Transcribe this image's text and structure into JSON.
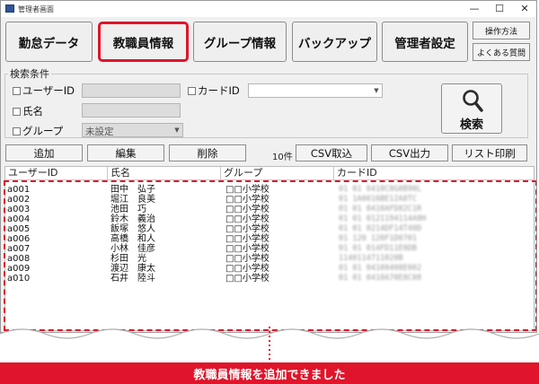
{
  "window": {
    "title": "管理者画面",
    "minimize": "—",
    "maximize": "☐",
    "close": "✕"
  },
  "tabs": [
    {
      "label": "勤怠データ",
      "active": false
    },
    {
      "label": "教職員情報",
      "active": true
    },
    {
      "label": "グループ情報",
      "active": false
    },
    {
      "label": "バックアップ",
      "active": false
    },
    {
      "label": "管理者設定",
      "active": false
    }
  ],
  "side_buttons": {
    "manual": "操作方法",
    "faq": "よくある質問"
  },
  "search": {
    "group_title": "検索条件",
    "user_id_label": "ユーザーID",
    "card_id_label": "カードID",
    "name_label": "氏名",
    "group_label": "グループ",
    "group_value": "未設定",
    "search_button": "検索"
  },
  "actions": {
    "add": "追加",
    "edit": "編集",
    "delete": "削除",
    "csv_import": "CSV取込",
    "csv_export": "CSV出力",
    "print_list": "リスト印刷"
  },
  "count": "10件",
  "table": {
    "columns": [
      "ユーザーID",
      "氏名",
      "グループ",
      "カードID"
    ],
    "rows": [
      {
        "id": "a001",
        "name": "田中　弘子",
        "group": "□□小学校",
        "card": "01 01 0410C0G0B90L"
      },
      {
        "id": "a002",
        "name": "堀江　良美",
        "group": "□□小学校",
        "card": "01 1A0016BE12A8TC"
      },
      {
        "id": "a003",
        "name": "池田　巧",
        "group": "□□小学校",
        "card": "01 01 0410AFD82C1R"
      },
      {
        "id": "a004",
        "name": "鈴木　義治",
        "group": "□□小学校",
        "card": "01 01 0121194114A8H"
      },
      {
        "id": "a005",
        "name": "飯塚　悠人",
        "group": "□□小学校",
        "card": "01 01 0214DF14T40D"
      },
      {
        "id": "a006",
        "name": "高橋　和人",
        "group": "□□小学校",
        "card": "01 120 120F1D0701"
      },
      {
        "id": "a007",
        "name": "小林　佳彦",
        "group": "□□小学校",
        "card": "01 01 014FD11E0DB"
      },
      {
        "id": "a008",
        "name": "杉田　光",
        "group": "□□小学校",
        "card": "1140114711020B"
      },
      {
        "id": "a009",
        "name": "渡辺　康太",
        "group": "□□小学校",
        "card": "01 01 04100408E002"
      },
      {
        "id": "a010",
        "name": "石井　陸斗",
        "group": "□□小学校",
        "card": "01 01 0410A70E8C08"
      }
    ]
  },
  "banner": "教職員情報を追加できました",
  "colors": {
    "accent": "#e0142a",
    "window_bg": "#f0f0f0"
  }
}
